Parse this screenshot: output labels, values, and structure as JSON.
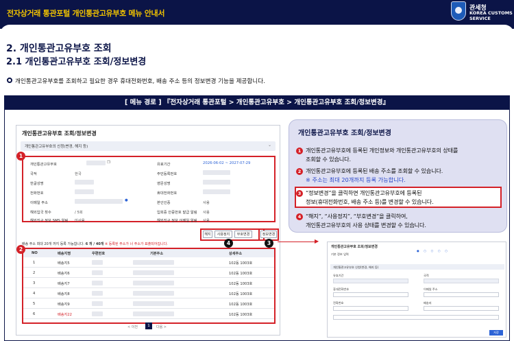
{
  "banner": {
    "title": "전자상거래 통관포털 개인통관고유부호 메뉴 안내서",
    "brand_kr": "관세청",
    "brand_en_1": "KOREA CUSTOMS",
    "brand_en_2": "SERVICE"
  },
  "headings": {
    "h1": "2. 개인통관고유부호 조회",
    "h2": "2.1 개인통관고유부호 조회/정보변경",
    "desc": "개인통관고유부호를 조회하고 필요한 경우 휴대전화번호, 배송 주소 등의 정보변경 기능을 제공합니다."
  },
  "route": "[ 메뉴 경로 ] 『전자상거래 통관포털 > 개인통관고유부호 > 개인통관고유부호 조회/정보변경』",
  "shot": {
    "title": "개인통관고유부호 조회/정보변경",
    "bar": "개인통관고유부호의 신청(변경, 해지 등)",
    "fields": {
      "code_label": "개인통관고유부호",
      "valid_label": "유효기간",
      "valid_value": "2026-06-02 ~ 2027-07-29",
      "nation_label": "국적",
      "nation_value": "한국",
      "resident_label": "주민등록번호",
      "name_kr_label": "한글성명",
      "name_en_label": "영문성명",
      "phone_label": "전화번호",
      "mobile_label": "휴대전화번호",
      "email_label": "이메일 주소",
      "verified_label": "본인인증",
      "verified_value": "사용",
      "count_label": "해외입국 횟수",
      "count_value": "/ 5회",
      "notice_label": "입회증 안중번호 발급 알림",
      "notice_value": "사용",
      "sms_label": "해외직구 정보 SMS 알림",
      "sms_value": "미사용",
      "foreign_label": "해외직구 정보 이메일 알림",
      "foreign_value": "사용"
    },
    "buttons": [
      "해지",
      "사용정지",
      "부호변경",
      "정보변경"
    ],
    "addr_note": "배송 주소 최대 20개 까지 등록 가능합니다.",
    "addr_count": "6 개 / 40개",
    "addr_warn": "※ 등록된 주소가 너 주소가 표출되어집니다.",
    "table": {
      "headers": [
        "NO",
        "배송지명",
        "우편번호",
        "기본주소",
        "상세주소"
      ],
      "rows": [
        {
          "no": "1",
          "name": "배송지5",
          "addr": "",
          "detail": "102동 1003호"
        },
        {
          "no": "2",
          "name": "배송지6",
          "addr": "",
          "detail": "102동 1003호"
        },
        {
          "no": "3",
          "name": "배송지7",
          "addr": "",
          "detail": "102동 1003호"
        },
        {
          "no": "4",
          "name": "배송지8",
          "addr": "",
          "detail": "102동 1003호"
        },
        {
          "no": "5",
          "name": "배송지9",
          "addr": "",
          "detail": "102동 1003호"
        },
        {
          "no": "6",
          "name": "배송지22",
          "addr": "",
          "detail": "102동 1003호"
        }
      ]
    },
    "pager": {
      "prev": "< 이전",
      "current": "1",
      "next": "다음 >"
    }
  },
  "panel": {
    "title": "개인통관고유부호 조회/정보변경",
    "items": [
      {
        "num": "1",
        "line1": "개인통관고유부호에 등록된 개인정보와 개인통관고유부호의 상태를",
        "line2": "조회할 수 있습니다."
      },
      {
        "num": "2",
        "line1": "개인통관고유부호에 등록된 배송 주소를 조회할 수 있습니다.",
        "note": "※ 주소는 최대 20개까지 등록 가능합니다."
      },
      {
        "num": "3",
        "line1": "“정보변경”을 클릭하면 개인통관고유부호에 등록된",
        "line2": "정보(휴대전화번호, 배송 주소 등)를 변경할 수 있습니다."
      },
      {
        "num": "4",
        "line1": "“해지”, “사용정지”, “부호변경”을 클릭하여,",
        "line2": "개인통관고유부호의 사용 상태를 변경할 수 있습니다."
      }
    ]
  },
  "shot2": {
    "title": "개인통관고유부호 조회/정보변경",
    "sub": "기본 정보 입력",
    "bar": "개인통관고유부호 신청(변경, 해지 등)",
    "labels": [
      "유효기간",
      "국적",
      "휴대전화번호",
      "이메일 주소",
      "전화번호",
      "배송지"
    ],
    "save": "저장"
  },
  "colors": {
    "navy": "#0b1447",
    "red": "#d42027",
    "gold": "#f0c200",
    "blue_note": "#2845c8",
    "panel_bg": "#dfe0f2"
  }
}
